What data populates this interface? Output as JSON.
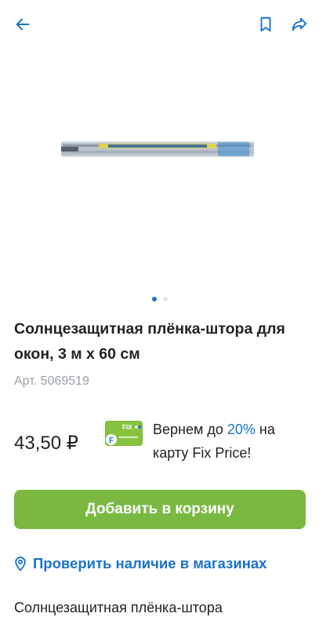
{
  "header": {
    "back_icon": "arrow-left-icon",
    "bookmark_icon": "bookmark-icon",
    "share_icon": "share-icon",
    "icon_color": "#1a73c9"
  },
  "gallery": {
    "image": "product-photo-film-roll",
    "pager_total": 2,
    "pager_active": 1
  },
  "product": {
    "title": "Солнцезащитная плёнка-штора для окон, 3 м х 60 см",
    "sku": "Арт. 5069519",
    "price": "43,50 ₽"
  },
  "cashback": {
    "text_before": "Вернем до ",
    "percent": "20%",
    "text_after": " на карту Fix Price!",
    "logo": "fix-price-card-logo"
  },
  "actions": {
    "add_to_cart": "Добавить в корзину",
    "add_to_cart_color": "#7ab842",
    "check_availability": "Проверить наличие в магазинах"
  },
  "description": {
    "first_line": "Солнцезащитная плёнка-штора"
  }
}
